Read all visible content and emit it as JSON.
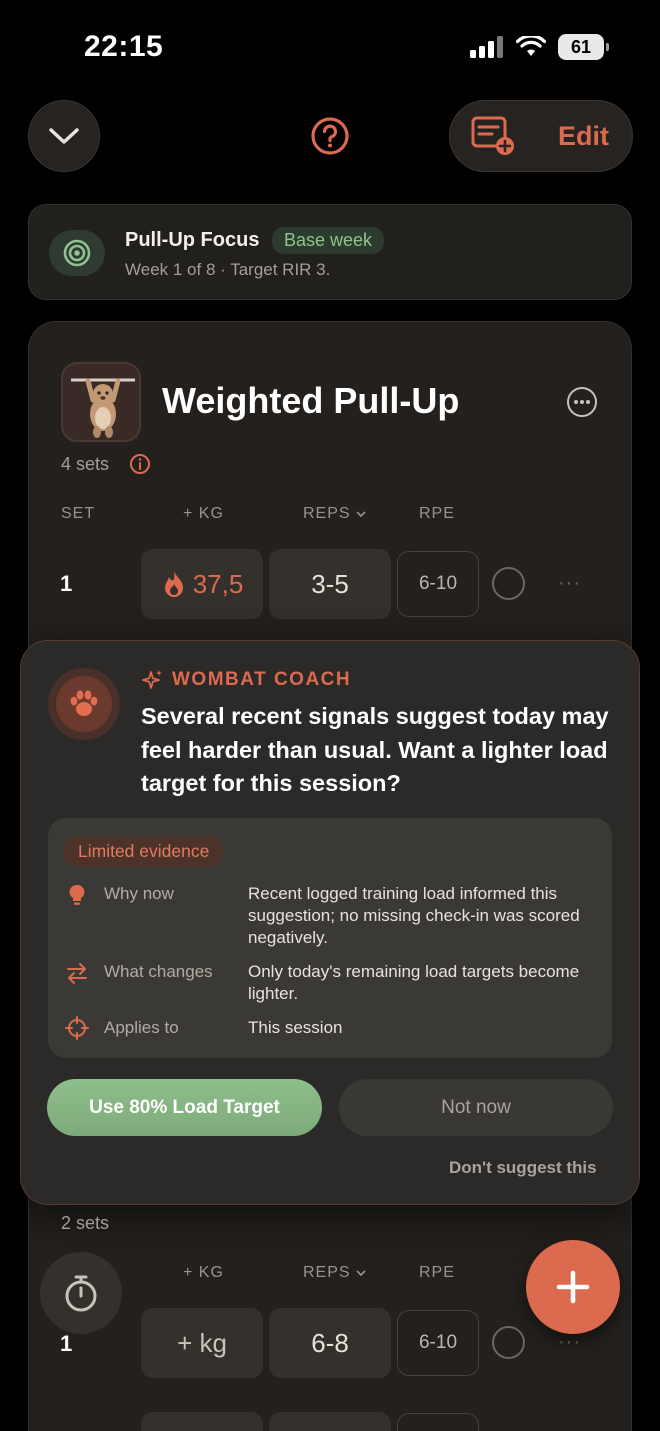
{
  "status_bar": {
    "time": "22:15",
    "battery": "61"
  },
  "nav": {
    "edit_label": "Edit"
  },
  "program": {
    "title": "Pull-Up Focus",
    "badge": "Base week",
    "subtitle": "Week 1 of 8 · Target RIR 3."
  },
  "exercise": {
    "title": "Weighted Pull-Up",
    "sets_count": "4 sets",
    "columns": {
      "set": "SET",
      "kg": "+ KG",
      "reps": "REPS",
      "rpe": "RPE"
    },
    "set_rows": [
      {
        "set": "1",
        "kg": "37,5",
        "reps": "3-5",
        "rpe": "6-10"
      }
    ]
  },
  "coach": {
    "label": "WOMBAT COACH",
    "message": "Several recent signals suggest today may feel harder than usual. Want a lighter load target for this session?",
    "evidence_badge": "Limited evidence",
    "evidence": [
      {
        "icon": "lightbulb-icon",
        "label": "Why now",
        "text": "Recent logged training load informed this suggestion; no missing check-in was scored negatively."
      },
      {
        "icon": "swap-arrows-icon",
        "label": "What changes",
        "text": "Only today's remaining load targets become lighter."
      },
      {
        "icon": "crosshair-icon",
        "label": "Applies to",
        "text": "This session"
      }
    ],
    "primary_label": "Use 80% Load Target",
    "secondary_label": "Not now",
    "dismiss_label": "Don't suggest this"
  },
  "exercise2": {
    "sets_count": "2 sets",
    "columns": {
      "kg": "+ KG",
      "reps": "REPS",
      "rpe": "RPE"
    },
    "set_rows": [
      {
        "set": "1",
        "kg": "+ kg",
        "reps": "6-8",
        "rpe": "6-10"
      }
    ]
  },
  "colors": {
    "accent": "#dc6a4e",
    "success": "#8fbf8c",
    "background": "#000000",
    "card": "#23201d"
  }
}
